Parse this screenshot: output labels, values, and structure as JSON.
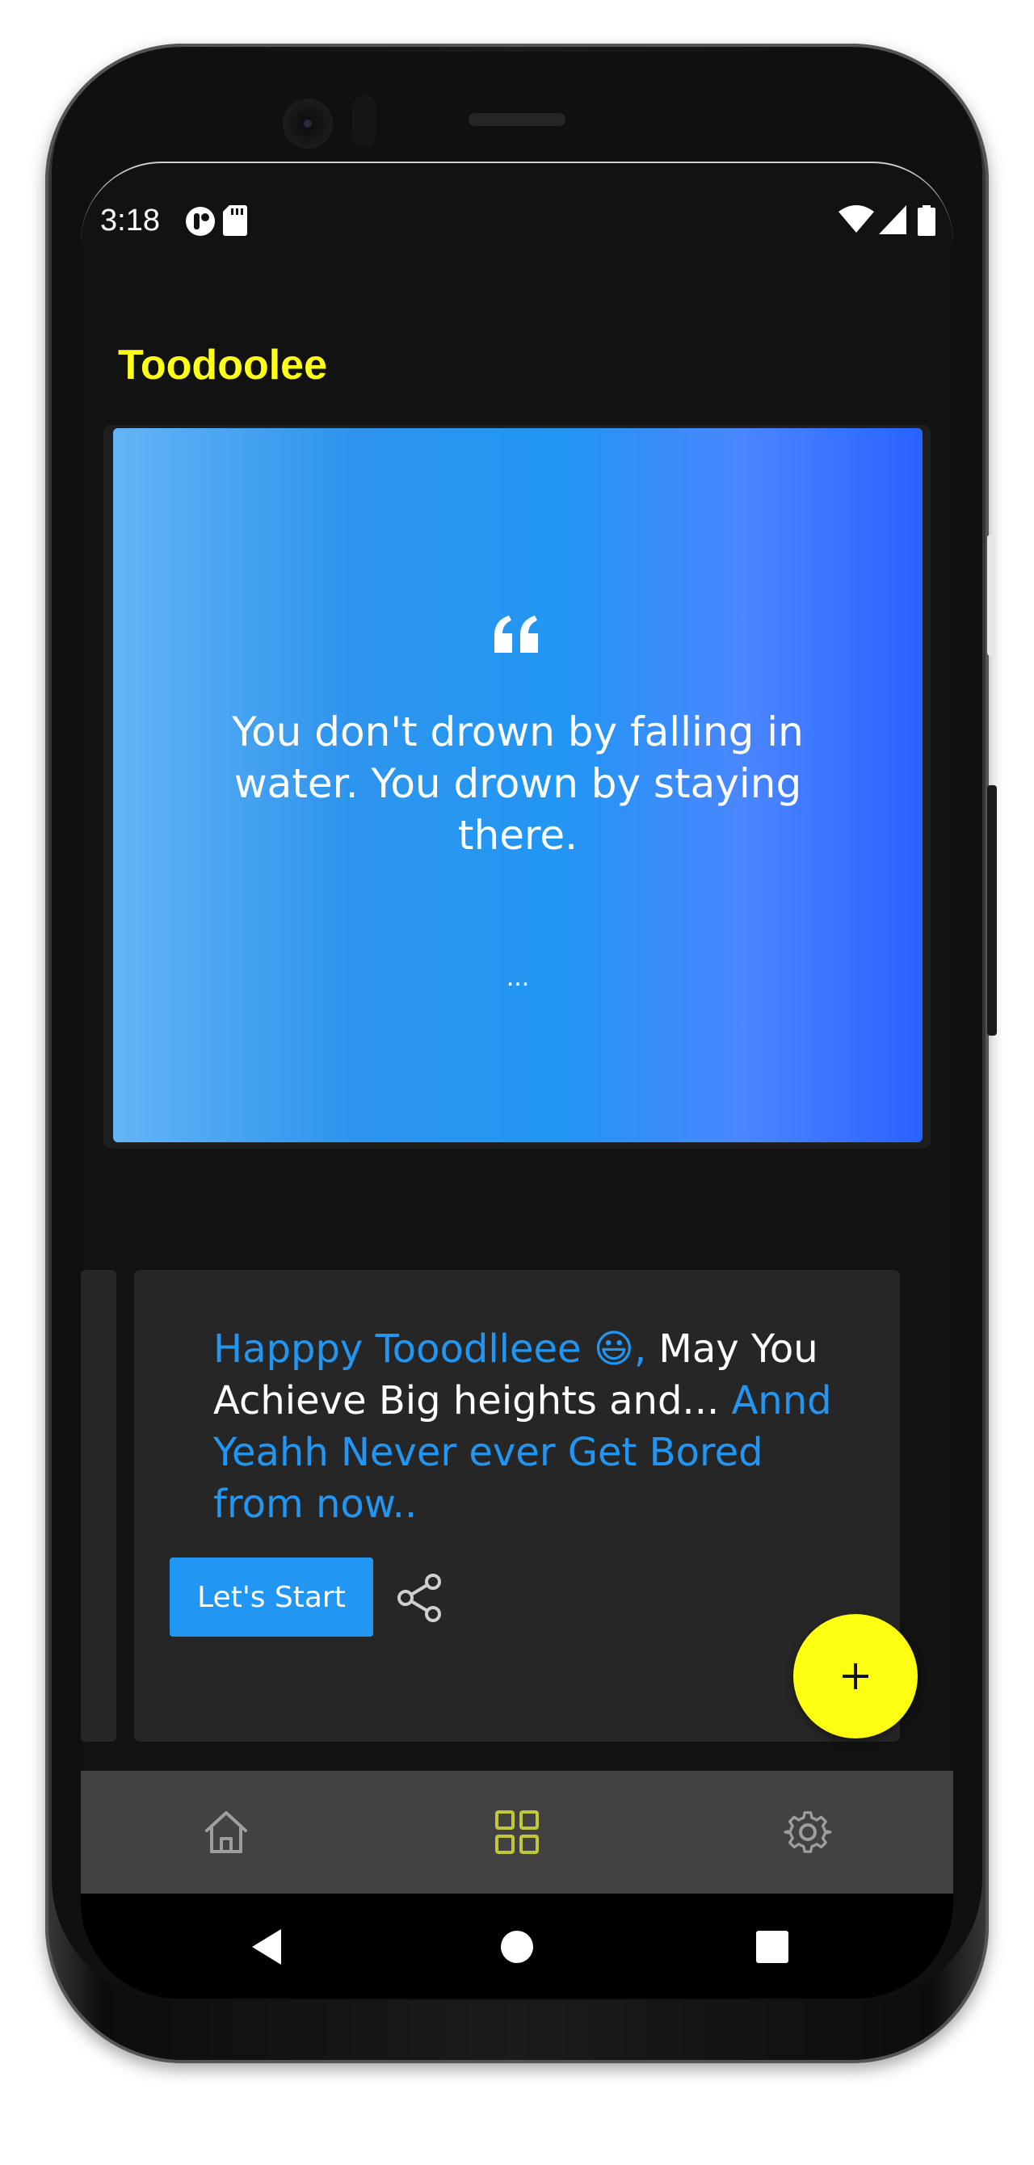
{
  "status_bar": {
    "time": "3:18",
    "icons": [
      "status-app-icon",
      "sd-card-icon",
      "wifi-icon",
      "signal-icon",
      "battery-icon"
    ]
  },
  "app": {
    "title": "Toodoolee",
    "title_color": "#ffff18"
  },
  "quote_card": {
    "icon": "quote-icon",
    "text": "You don't drown by falling in water. You drown by staying there.",
    "author": "..."
  },
  "promo_card": {
    "greeting": "Happpy Tooodlleee 😃,",
    "line_white": " May You Achieve Big heights and...",
    "line_blue": " Annd Yeahh Never ever Get Bored from now..",
    "start_label": "Let's Start",
    "share_icon": "share-icon",
    "accent": "#2196f3"
  },
  "fab": {
    "icon": "plus-icon",
    "color": "#ffff12"
  },
  "bottom_nav": {
    "items": [
      {
        "icon": "home-icon",
        "active": false
      },
      {
        "icon": "grid-icon",
        "active": true
      },
      {
        "icon": "gear-icon",
        "active": false
      }
    ],
    "active_color": "#c0c838",
    "inactive_color": "#9e9e9e"
  },
  "system_nav": {
    "buttons": [
      "back-icon",
      "home-circle-icon",
      "recents-icon"
    ]
  }
}
